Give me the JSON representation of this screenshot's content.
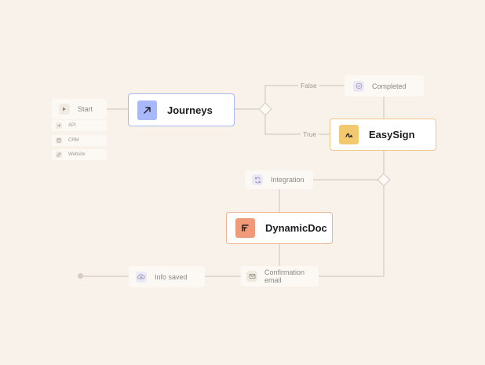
{
  "diagram": {
    "colors": {
      "background": "#f8f2ea",
      "journeys": "#a8b8fb",
      "easysign": "#f2c96e",
      "dynamicdoc": "#ef9a79",
      "journeys_border": "#a9b7f2",
      "easysign_border": "#f0c78a",
      "dynamicdoc_border": "#f0b290"
    },
    "nodes": {
      "start": "Start",
      "api": "API",
      "crm": "CRM",
      "website": "Website",
      "journeys": "Journeys",
      "completed": "Completed",
      "easysign": "EasySign",
      "integration": "Integration",
      "dynamicdoc": "DynamicDoc",
      "info_saved": "Info saved",
      "confirmation_email": "Confirmation email"
    },
    "edge_labels": {
      "false": "False",
      "true": "True"
    },
    "icons": {
      "start": "play-icon",
      "api": "send-icon",
      "crm": "database-icon",
      "website": "link-icon",
      "journeys": "arrow-up-right-icon",
      "completed": "check-circle-icon",
      "easysign": "signature-icon",
      "integration": "refresh-icon",
      "dynamicdoc": "document-layout-icon",
      "info_saved": "cloud-upload-icon",
      "confirmation_email": "mail-icon"
    }
  }
}
